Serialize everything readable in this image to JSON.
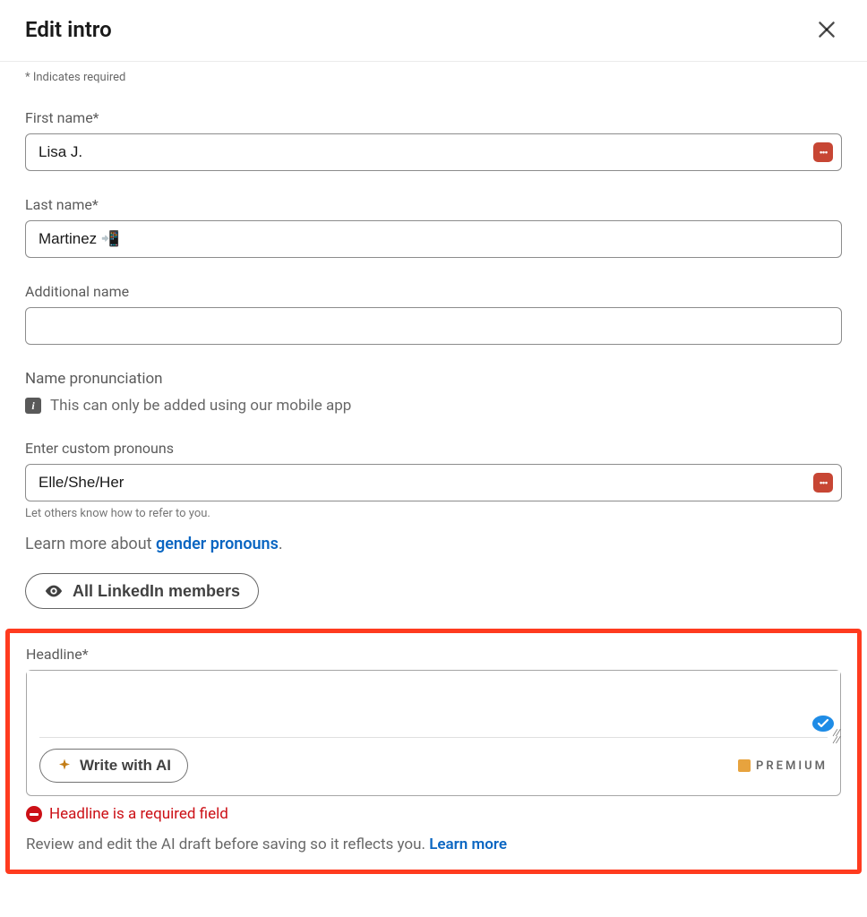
{
  "header": {
    "title": "Edit intro"
  },
  "required_note": "* Indicates required",
  "fields": {
    "first_name": {
      "label": "First name*",
      "value": "Lisa J."
    },
    "last_name": {
      "label": "Last name*",
      "value": "Martinez 📲"
    },
    "additional_name": {
      "label": "Additional name",
      "value": ""
    },
    "pronunciation": {
      "label": "Name pronunciation",
      "info": "This can only be added using our mobile app"
    },
    "pronouns": {
      "label": "Enter custom pronouns",
      "value": "Elle/She/Her",
      "helper": "Let others know how to refer to you.",
      "learn_prefix": "Learn more about ",
      "learn_link": "gender pronouns",
      "learn_suffix": "."
    },
    "visibility": {
      "label": "All LinkedIn members"
    },
    "headline": {
      "label": "Headline*",
      "value": "",
      "ai_button": "Write with AI",
      "premium": "PREMIUM",
      "error": "Headline is a required field",
      "review_text": "Review and edit the AI draft before saving so it reflects you. ",
      "review_link": "Learn more"
    }
  }
}
